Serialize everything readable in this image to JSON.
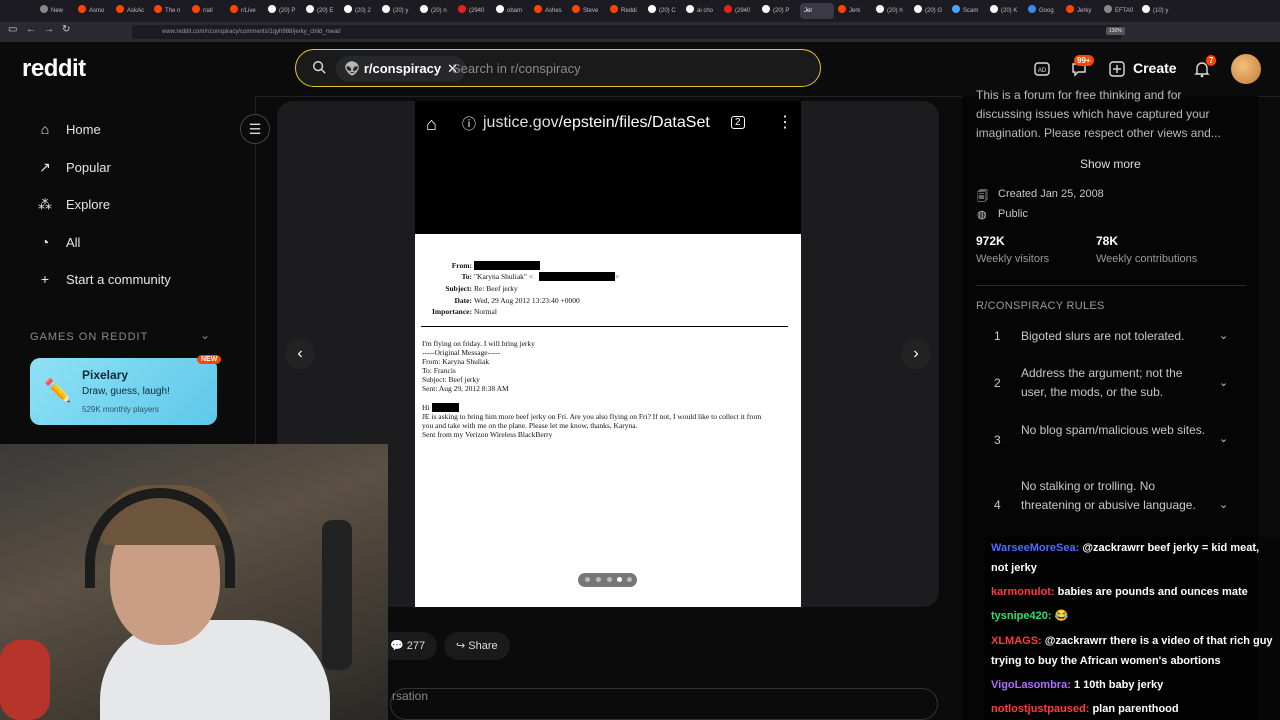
{
  "browser": {
    "tabs": [
      "New",
      "Asmo",
      "AskAc",
      "The n",
      "r/all",
      "r/Live",
      "(20) P",
      "(20) E",
      "(20) 2",
      "(20) y",
      "(20) n",
      "(2940",
      "obam",
      "Ashes",
      "Steve",
      "Reddi",
      "(20) C",
      "ai cho",
      "(2940",
      "(20) P",
      "Jerk",
      "(20) h",
      "(20) G",
      "Scam",
      "(20) K",
      "Goog",
      "Jerky",
      "EFTA0",
      "(10) y"
    ],
    "active_tab": "Jer",
    "url": "www.reddit.com/r/conspiracy/comments/1qyh988/jerky_child_meat/",
    "zoom": "130%"
  },
  "header": {
    "logo": "reddit",
    "search_chip": "r/conspiracy",
    "search_placeholder": "Search in r/conspiracy",
    "chat_badge": "99+",
    "create_label": "Create",
    "notif_badge": "7"
  },
  "sidebar": {
    "items": [
      {
        "label": "Home",
        "icon": "home-icon"
      },
      {
        "label": "Popular",
        "icon": "popular-icon"
      },
      {
        "label": "Explore",
        "icon": "explore-icon"
      },
      {
        "label": "All",
        "icon": "all-icon"
      },
      {
        "label": "Start a community",
        "icon": "plus-icon"
      }
    ],
    "games_heading": "GAMES ON REDDIT",
    "game": {
      "name": "Pixelary",
      "desc": "Draw, guess, laugh!",
      "stat": "529K monthly players",
      "badge": "NEW"
    }
  },
  "post": {
    "phone_url_domain": "justice.gov",
    "phone_url_path": "/epstein/files/DataSet",
    "tab_count": "2",
    "email": {
      "from_label": "From:",
      "to_label": "To:",
      "to_value": "\"Karyna Shuliak\" <",
      "to_end": ">",
      "subject_label": "Subject:",
      "subject_value": "Re: Beef jerky",
      "date_label": "Date:",
      "date_value": "Wed, 29 Aug 2012 13:23:40 +0000",
      "importance_label": "Importance:",
      "importance_value": "Normal",
      "body": [
        "I'm flying on friday. I will bring jerky",
        "-----Original Message-----",
        "From: Karyna Shuliak",
        "To: Francis",
        "Subject: Beef jerky",
        "Sent: Aug 29, 2012 8:38 AM"
      ],
      "greeting": "Hi",
      "message": [
        "JE is asking to bring him more beef jerky on Fri. Are you also flying on Fri? If not, I would like to collect it from",
        "you and take with me on the plane. Please let me know, thanks, Karyna.",
        "Sent from my Verizon Wireless BlackBerry"
      ]
    },
    "comment_count": "277",
    "share_label": "Share",
    "conversation_partial": "rsation"
  },
  "right": {
    "description": [
      "This is a forum for free thinking and for",
      "discussing issues which have captured your",
      "imagination. Please respect other views and..."
    ],
    "show_more": "Show more",
    "created": "Created Jan 25, 2008",
    "visibility": "Public",
    "visitors_value": "972K",
    "visitors_label": "Weekly visitors",
    "contrib_value": "78K",
    "contrib_label": "Weekly contributions",
    "rules_heading": "R/CONSPIRACY RULES",
    "rules": [
      {
        "num": "1",
        "text": "Bigoted slurs are not tolerated."
      },
      {
        "num": "2",
        "text": "Address the argument; not the user, the mods, or the sub."
      },
      {
        "num": "3",
        "text": "No blog spam/malicious web sites."
      },
      {
        "num": "4",
        "text": "No stalking or trolling. No threatening or abusive language."
      }
    ]
  },
  "chat": [
    {
      "user": "WarseeMoreSea:",
      "color": "#4f6bff",
      "msg": "@zackrawrr beef jerky = kid meat, not jerky"
    },
    {
      "user": "karmonulot:",
      "color": "#ff3b3b",
      "msg": "babies are pounds and ounces mate"
    },
    {
      "user": "tysnipe420:",
      "color": "#2ee06a",
      "msg": "😂"
    },
    {
      "user": "XLMAGS:",
      "color": "#ff3b3b",
      "msg": "@zackrawrr there is a video of that rich guy trying to buy the African women's abortions"
    },
    {
      "user": "VigoLasombra:",
      "color": "#b06bff",
      "msg": "1 10th baby jerky"
    },
    {
      "user": "notlostjustpaused:",
      "color": "#ff3b3b",
      "msg": "plan parenthood"
    }
  ]
}
